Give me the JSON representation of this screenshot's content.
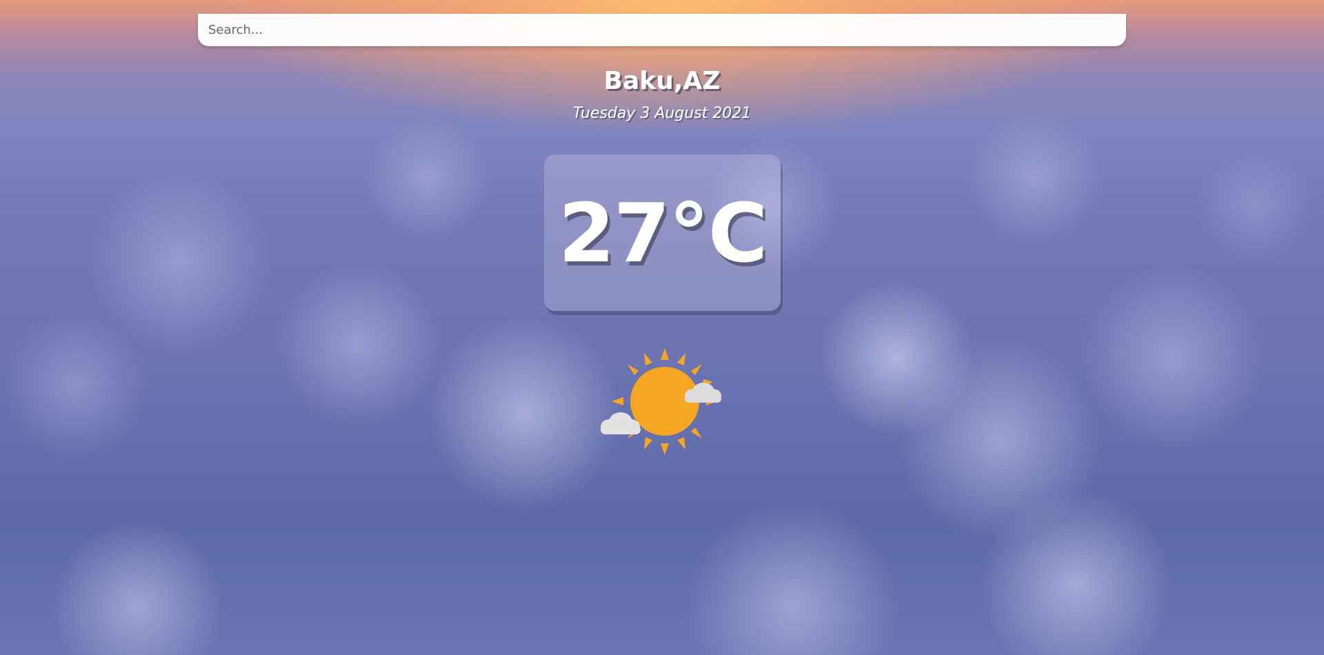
{
  "search": {
    "placeholder": "Search...",
    "value": ""
  },
  "location": {
    "name": "Baku,AZ",
    "date": "Tuesday 3 August 2021"
  },
  "weather": {
    "temperature": "27°C",
    "icon": "partly-sunny-icon"
  },
  "colors": {
    "sun": "#f5a623",
    "cloud_icon": "#d9d9d9",
    "text": "#ffffff"
  }
}
